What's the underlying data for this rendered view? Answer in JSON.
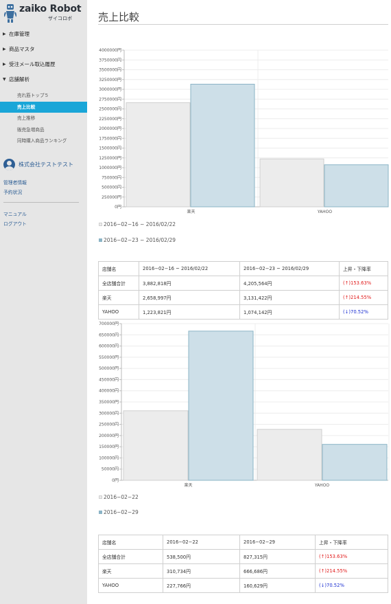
{
  "app": {
    "logo_title": "zaiko Robot",
    "logo_sub": "ザイコロボ"
  },
  "sidebar": {
    "sections": [
      {
        "label": "在庫管理"
      },
      {
        "label": "商品マスタ"
      },
      {
        "label": "受注メール取込履歴"
      },
      {
        "label": "店舗解析"
      }
    ],
    "sub_items": [
      {
        "label": "売れ筋トップ５"
      },
      {
        "label": "売上比較",
        "active": true
      },
      {
        "label": "売上推移"
      },
      {
        "label": "販売急増商品"
      },
      {
        "label": "同時購入商品ランキング"
      }
    ],
    "company": "株式会社テストテスト",
    "links_admin": [
      "管理者情報",
      "予約状況"
    ],
    "links_help": [
      "マニュアル",
      "ログアウト"
    ]
  },
  "page": {
    "title": "売上比較"
  },
  "colors": {
    "series1": "#ececec",
    "series1_border": "#cfcfcf",
    "series2": "#cddfe8",
    "series2_border": "#8bb4c6",
    "up": "#e11b1b",
    "down": "#1b2fd1",
    "active_nav": "#1aa6d8",
    "brand": "#2e5f95"
  },
  "chart_data": [
    {
      "type": "bar",
      "categories": [
        "楽天",
        "YAHOO"
      ],
      "series": [
        {
          "name": "2016−02−16 ~ 2016/02/22",
          "values": [
            2658997,
            1223821
          ]
        },
        {
          "name": "2016−02−23 ~ 2016/02/29",
          "values": [
            3131422,
            1074142
          ]
        }
      ],
      "ylim": [
        0,
        4000000
      ],
      "ystep": 250000,
      "yunit": "円",
      "grid": true,
      "legend": "bottom"
    },
    {
      "type": "bar",
      "categories": [
        "楽天",
        "YAHOO"
      ],
      "series": [
        {
          "name": "2016−02−22",
          "values": [
            310734,
            227766
          ]
        },
        {
          "name": "2016−02−29",
          "values": [
            666686,
            160629
          ]
        }
      ],
      "ylim": [
        0,
        700000
      ],
      "ystep": 50000,
      "yunit": "円",
      "grid": true,
      "legend": "bottom"
    }
  ],
  "tables": [
    {
      "headers": [
        "店舗名",
        "2016−02−16 ~ 2016/02/22",
        "2016−02−23 ~ 2016/02/29",
        "上昇・下降率"
      ],
      "rows": [
        {
          "store": "全店舗合計",
          "a": "3,882,818円",
          "b": "4,205,564円",
          "rate": "(↑)153.63%",
          "dir": "up"
        },
        {
          "store": "楽天",
          "a": "2,658,997円",
          "b": "3,131,422円",
          "rate": "(↑)214.55%",
          "dir": "up"
        },
        {
          "store": "YAHOO",
          "a": "1,223,821円",
          "b": "1,074,142円",
          "rate": "(↓)70.52%",
          "dir": "down"
        }
      ]
    },
    {
      "headers": [
        "店舗名",
        "2016−02−22",
        "2016−02−29",
        "上昇・下降率"
      ],
      "rows": [
        {
          "store": "全店舗合計",
          "a": "538,500円",
          "b": "827,315円",
          "rate": "(↑)153.63%",
          "dir": "up"
        },
        {
          "store": "楽天",
          "a": "310,734円",
          "b": "666,686円",
          "rate": "(↑)214.55%",
          "dir": "up"
        },
        {
          "store": "YAHOO",
          "a": "227,766円",
          "b": "160,629円",
          "rate": "(↓)70.52%",
          "dir": "down"
        }
      ]
    }
  ]
}
